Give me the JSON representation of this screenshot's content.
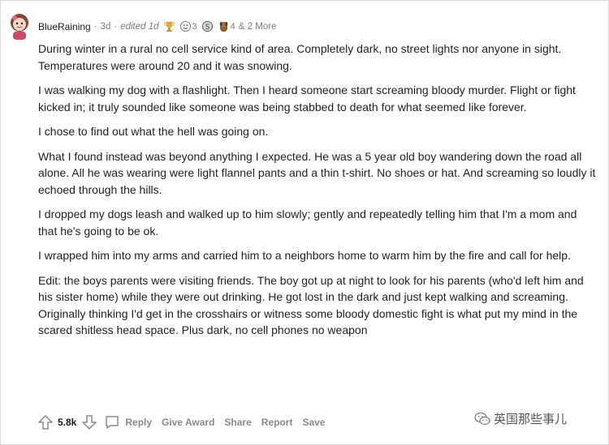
{
  "comment": {
    "username": "BlueRaining",
    "age": "3d",
    "edited": "edited 1d",
    "separator": "·",
    "awards": [
      {
        "name": "trophy-award",
        "count": ""
      },
      {
        "name": "tear-award",
        "count": "3"
      },
      {
        "name": "silver-award",
        "count": ""
      },
      {
        "name": "dog-award",
        "count": "4"
      }
    ],
    "more": "& 2 More",
    "paragraphs": [
      "During winter in a rural no cell service kind of area. Completely dark, no street lights nor anyone in sight. Temperatures were around 20 and it was snowing.",
      "I was walking my dog with a flashlight. Then I heard someone start screaming bloody murder. Flight or fight kicked in; it truly sounded like someone was being stabbed to death for what seemed like forever.",
      "I chose to find out what the hell was going on.",
      "What I found instead was beyond anything I expected. He was a 5 year old boy wandering down the road all alone. All he was wearing were light flannel pants and a thin t-shirt. No shoes or hat. And screaming so loudly it echoed through the hills.",
      "I dropped my dogs leash and walked up to him slowly; gently and repeatedly telling him that I'm a mom and that he's going to be ok.",
      "I wrapped him into my arms and carried him to a neighbors home to warm him by the fire and call for help.",
      "Edit: the boys parents were visiting friends. The boy got up at night to look for his parents (who'd left him and his sister home) while they were out drinking. He got lost in the dark and just kept walking and screaming. Originally thinking I'd get in the crosshairs or witness some bloody domestic fight is what put my mind in the scared shitless head space. Plus dark, no cell phones no weapon"
    ],
    "score": "5.8k",
    "actions": {
      "reply": "Reply",
      "give_award": "Give Award",
      "share": "Share",
      "report": "Report",
      "save": "Save"
    }
  },
  "watermark": {
    "text": "英国那些事儿"
  }
}
